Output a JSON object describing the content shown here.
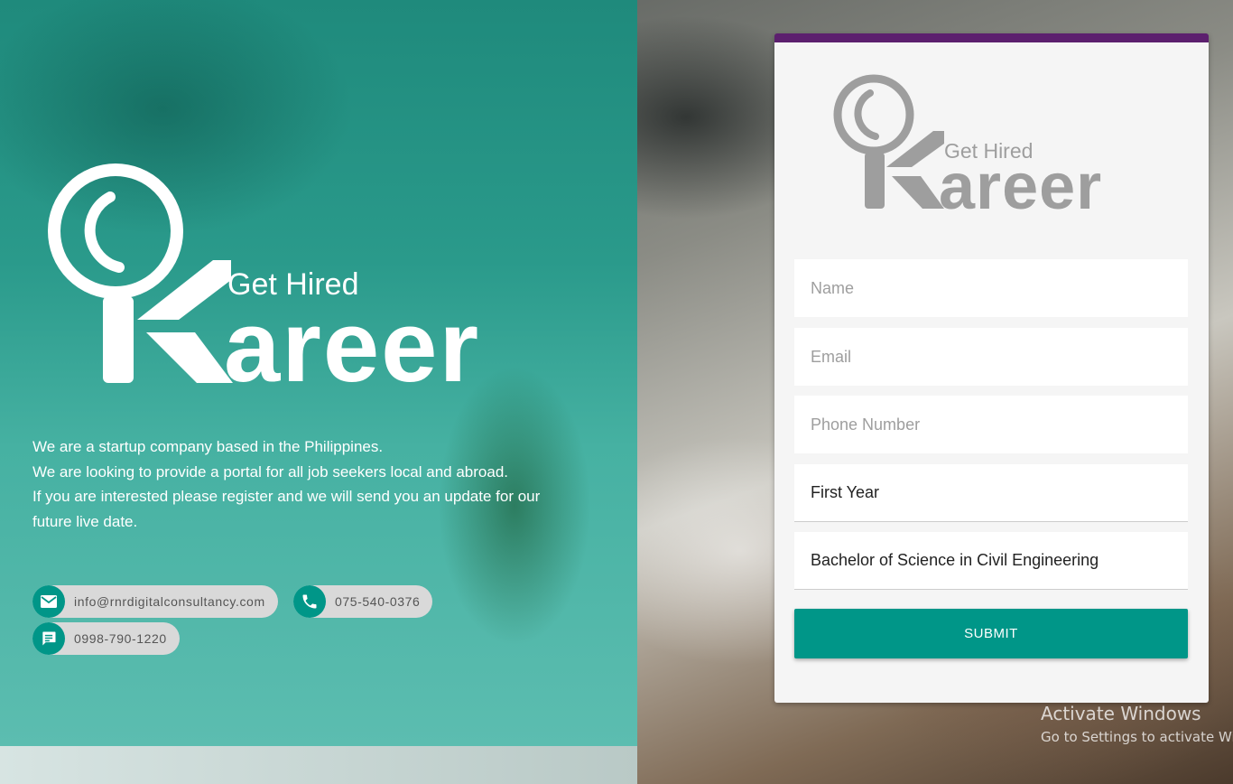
{
  "colors": {
    "accent": "#009688",
    "card_top_border": "#5c1f6e",
    "panel_teal": "#2a9a8b",
    "pill_bg": "#d9d9d9"
  },
  "brand": {
    "tagline": "Get Hired",
    "wordmark": "areer",
    "logo_icon": "magnifier-k-icon"
  },
  "intro": {
    "line1": "We are a startup company based in the Philippines.",
    "line2": "We are looking to provide a portal for all job seekers local and abroad.",
    "line3": "If you are interested please register and we will send you an update for our future live date."
  },
  "contacts": {
    "email": {
      "icon": "mail-icon",
      "text": "info@rnrdigitalconsultancy.com"
    },
    "phone": {
      "icon": "phone-icon",
      "text": "075-540-0376"
    },
    "mobile": {
      "icon": "message-icon",
      "text": "0998-790-1220"
    }
  },
  "form": {
    "name_placeholder": "Name",
    "email_placeholder": "Email",
    "phone_placeholder": "Phone Number",
    "year_value": "First Year",
    "course_value": "Bachelor of Science in Civil Engineering",
    "submit_label": "SUBMIT"
  },
  "os_watermark": {
    "title": "Activate Windows",
    "subtitle": "Go to Settings to activate Windows."
  }
}
